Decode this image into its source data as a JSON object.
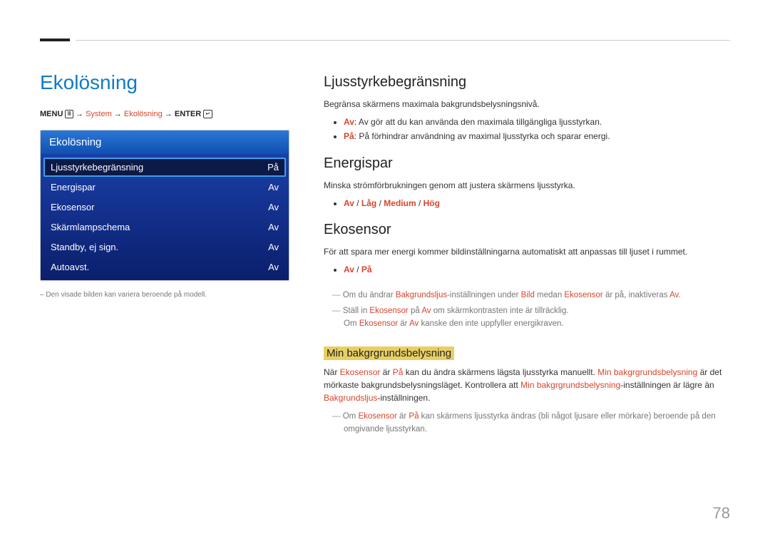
{
  "page_number": "78",
  "main_title": "Ekolösning",
  "breadcrumb": {
    "menu": "MENU",
    "step1": "System",
    "step2": "Ekolösning",
    "enter": "ENTER",
    "arrow": "→"
  },
  "panel": {
    "title": "Ekolösning",
    "rows": [
      {
        "label": "Ljusstyrkebegränsning",
        "value": "På",
        "selected": true
      },
      {
        "label": "Energispar",
        "value": "Av",
        "selected": false
      },
      {
        "label": "Ekosensor",
        "value": "Av",
        "selected": false
      },
      {
        "label": "Skärmlampschema",
        "value": "Av",
        "selected": false
      },
      {
        "label": "Standby, ej sign.",
        "value": "Av",
        "selected": false
      },
      {
        "label": "Autoavst.",
        "value": "Av",
        "selected": false
      }
    ]
  },
  "footnote_left": "– Den visade bilden kan variera beroende på modell.",
  "sections": {
    "s1": {
      "title": "Ljusstyrkebegränsning",
      "intro": "Begränsa skärmens maximala bakgrundsbelysningsnivå.",
      "b1_pre": "Av",
      "b1_rest": ": Av gör att du kan använda den maximala tillgängliga ljusstyrkan.",
      "b2_pre": "På",
      "b2_rest": ": På förhindrar användning av maximal ljusstyrka och sparar energi."
    },
    "s2": {
      "title": "Energispar",
      "intro": "Minska strömförbrukningen genom att justera skärmens ljusstyrka.",
      "opts": [
        "Av",
        "Låg",
        "Medium",
        "Hög"
      ]
    },
    "s3": {
      "title": "Ekosensor",
      "intro": "För att spara mer energi kommer bildinställningarna automatiskt att anpassas till ljuset i rummet.",
      "opts": [
        "Av",
        "På"
      ],
      "note1_a": "Om du ändrar ",
      "note1_b": "Bakgrundsljus",
      "note1_c": "-inställningen under ",
      "note1_d": "Bild",
      "note1_e": " medan ",
      "note1_f": "Ekosensor",
      "note1_g": " är på, inaktiveras ",
      "note1_h": "Av",
      "note1_i": ".",
      "note2_a": "Ställ in ",
      "note2_b": "Ekosensor",
      "note2_c": " på ",
      "note2_d": "Av",
      "note2_e": " om skärmkontrasten inte är tillräcklig.",
      "note2_line2_a": "Om ",
      "note2_line2_b": "Ekosensor",
      "note2_line2_c": " är ",
      "note2_line2_d": "Av",
      "note2_line2_e": " kanske den inte uppfyller energikraven.",
      "sub_title": "Min bakgrgrundsbelysning",
      "sub_p1_a": "När ",
      "sub_p1_b": "Ekosensor",
      "sub_p1_c": " är ",
      "sub_p1_d": "På",
      "sub_p1_e": " kan du ändra skärmens lägsta ljusstyrka manuellt. ",
      "sub_p1_f": "Min bakgrgrundsbelysning",
      "sub_p1_g": " är det mörkaste bakgrundsbelysningsläget. Kontrollera att ",
      "sub_p1_h": "Min bakgrgrundsbelysning",
      "sub_p1_i": "-inställningen är lägre än ",
      "sub_p1_j": "Bakgrundsljus",
      "sub_p1_k": "-inställningen.",
      "sub_note_a": "Om ",
      "sub_note_b": "Ekosensor",
      "sub_note_c": " är ",
      "sub_note_d": "På",
      "sub_note_e": " kan skärmens ljusstyrka ändras (bli något ljusare eller mörkare) beroende på den omgivande ljusstyrkan."
    }
  }
}
